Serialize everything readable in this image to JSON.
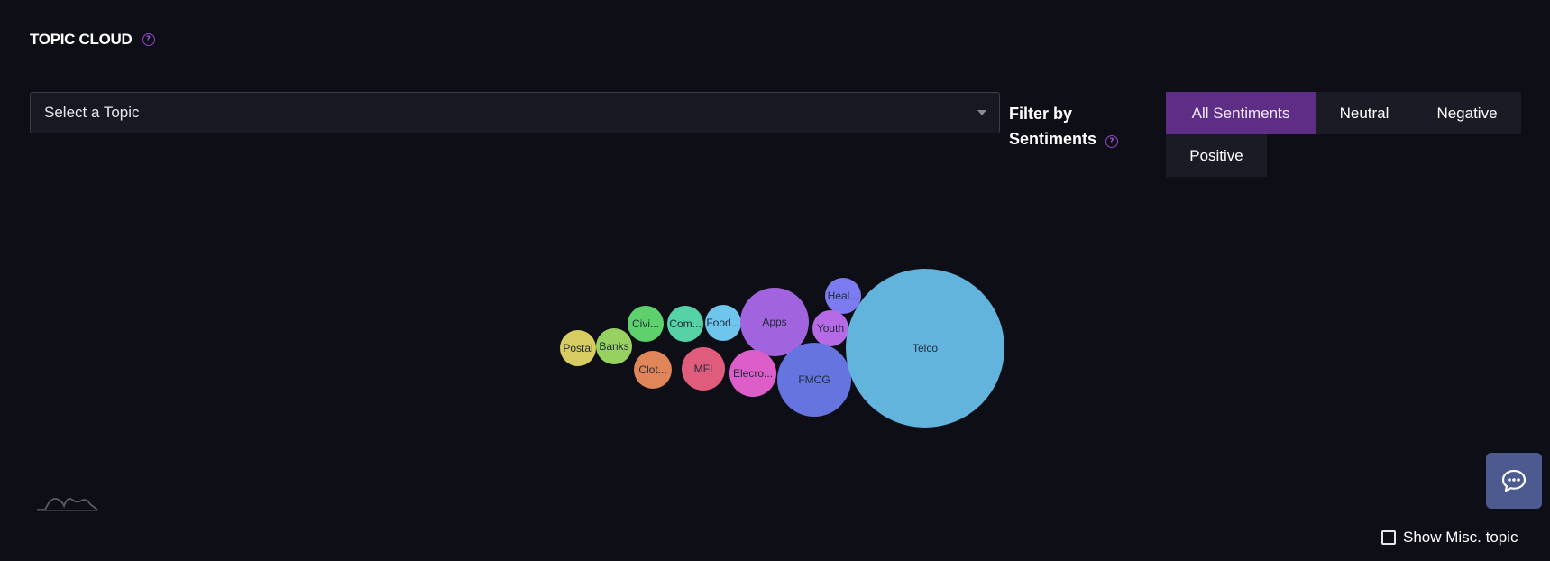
{
  "header": {
    "title": "TOPIC CLOUD",
    "help_glyph": "?"
  },
  "topic_select": {
    "placeholder": "Select a Topic"
  },
  "sentiment_filter": {
    "label": "Filter by Sentiments",
    "help_glyph": "?",
    "options": [
      {
        "label": "All Sentiments",
        "active": true
      },
      {
        "label": "Neutral",
        "active": false
      },
      {
        "label": "Negative",
        "active": false
      },
      {
        "label": "Positive",
        "active": false
      }
    ]
  },
  "bubbles": [
    {
      "label": "Postal",
      "color": "#d6cc62"
    },
    {
      "label": "Banks",
      "color": "#97d15f"
    },
    {
      "label": "Civi...",
      "color": "#5ed16c"
    },
    {
      "label": "Com...",
      "color": "#55d3a6"
    },
    {
      "label": "Food...",
      "color": "#6ec6ec"
    },
    {
      "label": "Apps",
      "color": "#a263de"
    },
    {
      "label": "Heal...",
      "color": "#7c7cf0"
    },
    {
      "label": "Youth",
      "color": "#b66ae6"
    },
    {
      "label": "Clot...",
      "color": "#e0855a"
    },
    {
      "label": "MFI",
      "color": "#e05c7c"
    },
    {
      "label": "Elecro...",
      "color": "#dd5ec9"
    },
    {
      "label": "FMCG",
      "color": "#6574de"
    },
    {
      "label": "Telco",
      "color": "#62b4dc"
    }
  ],
  "chat": {
    "icon": "chat-bubble-icon"
  },
  "misc_toggle": {
    "label": "Show Misc. topic",
    "checked": false
  }
}
